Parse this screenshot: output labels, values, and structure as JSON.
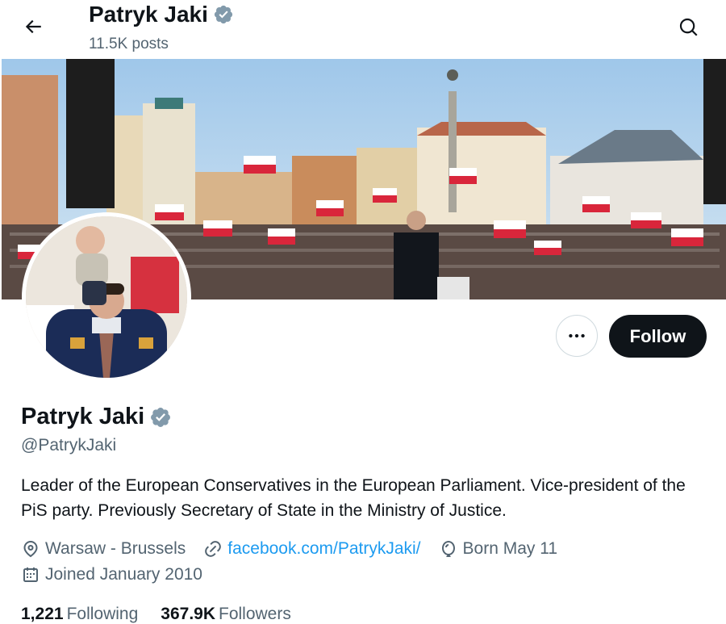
{
  "header": {
    "title": "Patryk Jaki",
    "post_count": "11.5K posts"
  },
  "profile": {
    "name": "Patryk Jaki",
    "handle": "@PatrykJaki",
    "bio": "Leader of the European Conservatives in the European Parliament. Vice-president of the PiS party. Previously Secretary of State in the Ministry of Justice.",
    "location": "Warsaw - Brussels",
    "website": "facebook.com/PatrykJaki/",
    "birthday": "Born May 11",
    "joined": "Joined January 2010",
    "following_count": "1,221",
    "following_label": "Following",
    "followers_count": "367.9K",
    "followers_label": "Followers"
  },
  "actions": {
    "follow_label": "Follow"
  },
  "icons": {
    "back": "back-arrow-icon",
    "search": "search-icon",
    "verified": "verified-badge-icon",
    "more": "more-horizontal-icon",
    "location": "location-pin-icon",
    "link": "link-icon",
    "birthday": "balloon-icon",
    "calendar": "calendar-icon"
  },
  "colors": {
    "accent": "#1d9bf0",
    "text": "#0f1419",
    "secondary_text": "#536471",
    "verified": "#829aab",
    "follow_button": "#0f1419"
  }
}
